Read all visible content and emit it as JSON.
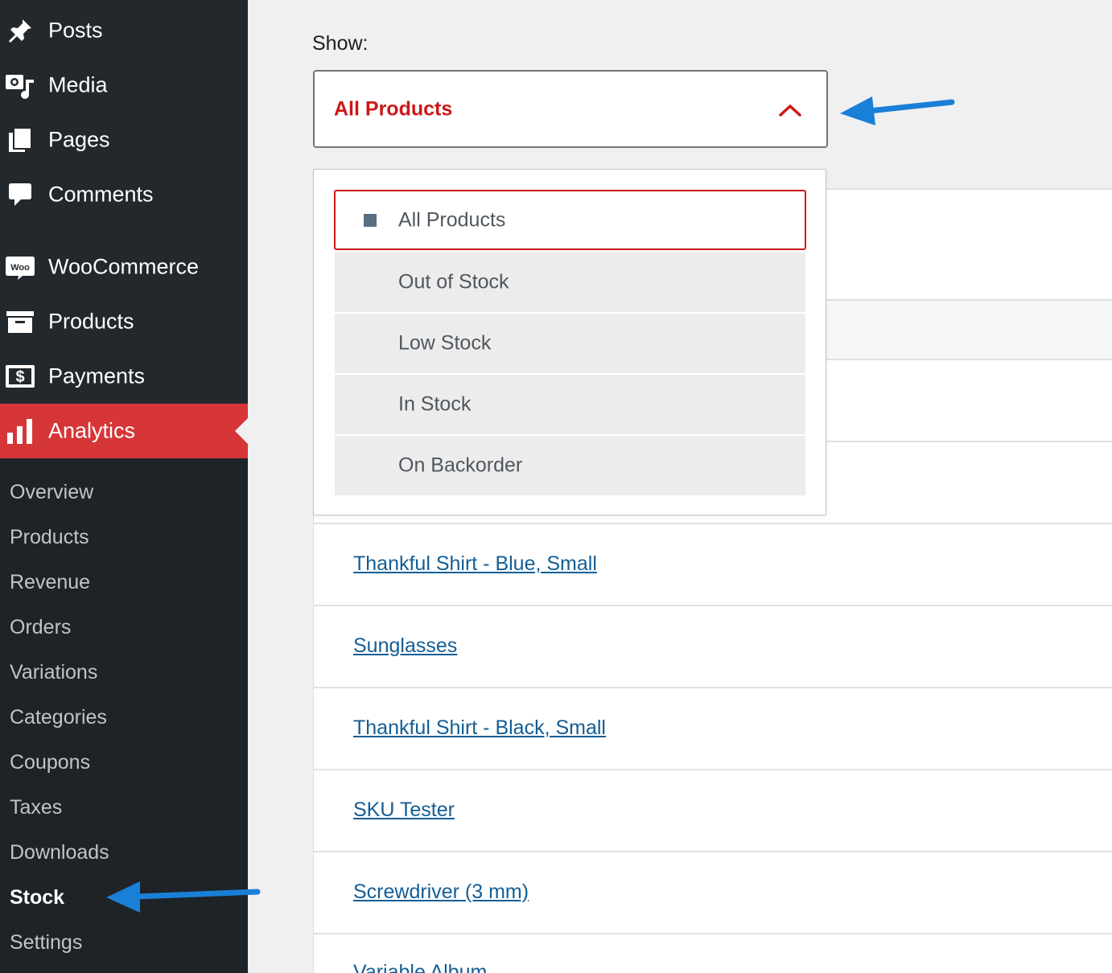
{
  "sidebar": {
    "menu": [
      {
        "label": "Posts",
        "icon": "pin-icon"
      },
      {
        "label": "Media",
        "icon": "media-icon"
      },
      {
        "label": "Pages",
        "icon": "pages-icon"
      },
      {
        "label": "Comments",
        "icon": "comment-icon"
      },
      {
        "label": "WooCommerce",
        "icon": "woo-icon"
      },
      {
        "label": "Products",
        "icon": "archive-icon"
      },
      {
        "label": "Payments",
        "icon": "dollar-icon"
      },
      {
        "label": "Analytics",
        "icon": "chart-bar-icon",
        "active": true
      }
    ],
    "woo_badge": "Woo",
    "dollar_glyph": "$",
    "submenu": [
      {
        "label": "Overview"
      },
      {
        "label": "Products"
      },
      {
        "label": "Revenue"
      },
      {
        "label": "Orders"
      },
      {
        "label": "Variations"
      },
      {
        "label": "Categories"
      },
      {
        "label": "Coupons"
      },
      {
        "label": "Taxes"
      },
      {
        "label": "Downloads"
      },
      {
        "label": "Stock",
        "current": true
      },
      {
        "label": "Settings"
      }
    ]
  },
  "filter": {
    "show_label": "Show:",
    "selected": "All Products",
    "options": [
      "All Products",
      "Out of Stock",
      "Low Stock",
      "In Stock",
      "On Backorder"
    ]
  },
  "table": {
    "rows": [
      "Thankful Shirt - Blue, Small",
      "Sunglasses",
      "Thankful Shirt - Black, Small",
      "SKU Tester",
      "Screwdriver (3 mm)",
      "Variable Album"
    ]
  },
  "colors": {
    "accent": "#d63638",
    "sidebar": "#23282d",
    "submenu": "#1d2327",
    "link": "#135e96",
    "selected_text": "#cc1818",
    "annotation_arrow": "#1a7fd6"
  }
}
